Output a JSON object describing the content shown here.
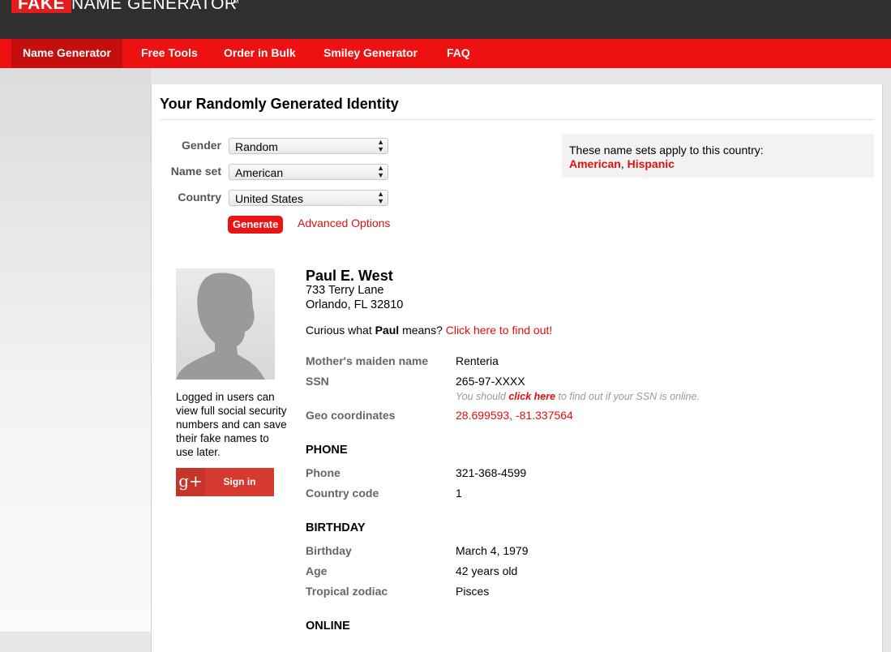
{
  "brand": {
    "fake": "FAKE",
    "rest": "NAME GENERATOR",
    "tm": "TM"
  },
  "nav": [
    {
      "label": "Name Generator",
      "active": true
    },
    {
      "label": "Free Tools"
    },
    {
      "label": "Order in Bulk"
    },
    {
      "label": "Smiley Generator"
    },
    {
      "label": "FAQ"
    }
  ],
  "page_title": "Your Randomly Generated Identity",
  "form": {
    "gender_label": "Gender",
    "gender_value": "Random",
    "nameset_label": "Name set",
    "nameset_value": "American",
    "country_label": "Country",
    "country_value": "United States",
    "generate_label": "Generate",
    "advanced_label": "Advanced Options"
  },
  "country_box": {
    "note": "These name sets apply to this country:",
    "sets": [
      "American",
      "Hispanic"
    ],
    "separator": ","
  },
  "login": {
    "text": "Logged in users can view full social security numbers and can save their fake names to use later.",
    "gplus": "g+",
    "signin_label": "Sign in"
  },
  "identity": {
    "name": "Paul E. West",
    "address_line1": "733 Terry Lane",
    "address_line2": "Orlando, FL 32810",
    "curious_prefix": "Curious what",
    "first_name": "Paul",
    "curious_suffix": "means?",
    "curious_link": "Click here to find out!"
  },
  "details": {
    "maiden_label": "Mother's maiden name",
    "maiden_value": "Renteria",
    "ssn_label": "SSN",
    "ssn_value": "265-97-XXXX",
    "ssn_note_prefix": "You should",
    "ssn_note_link": "click here",
    "ssn_note_suffix": "to find out if your SSN is online.",
    "geo_label": "Geo coordinates",
    "geo_value": "28.699593, -81.337564"
  },
  "phone_section": {
    "heading": "PHONE",
    "phone_label": "Phone",
    "phone_value": "321-368-4599",
    "code_label": "Country code",
    "code_value": "1"
  },
  "birthday_section": {
    "heading": "BIRTHDAY",
    "birthday_label": "Birthday",
    "birthday_value": "March 4, 1979",
    "age_label": "Age",
    "age_value": "42 years old",
    "zodiac_label": "Tropical zodiac",
    "zodiac_value": "Pisces"
  },
  "online_section": {
    "heading": "ONLINE"
  },
  "colors": {
    "accent": "#ee1111",
    "nav_active": "#c50f0f",
    "topbar": "#2f2f2f",
    "link": "#e01010"
  },
  "icons": {
    "select_arrow": "up-down-arrow-icon",
    "avatar": "person-silhouette-icon",
    "gplus": "google-plus-icon"
  }
}
